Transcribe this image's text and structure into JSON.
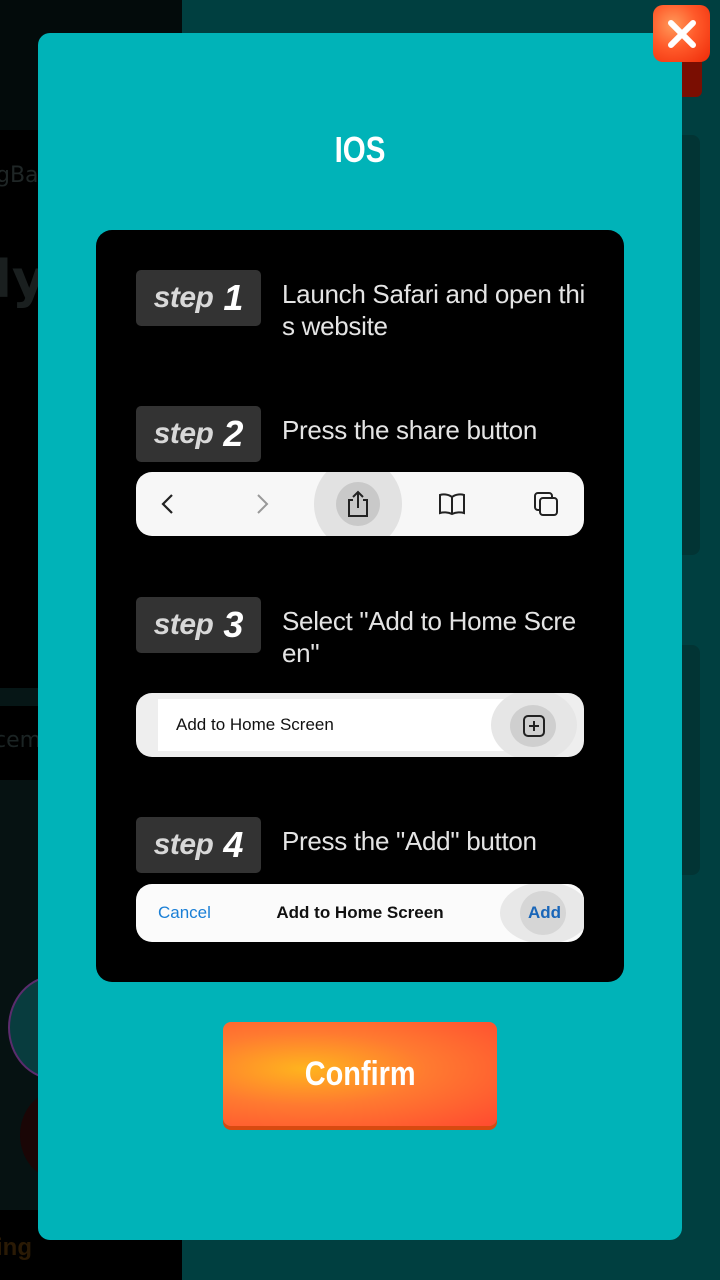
{
  "background": {
    "partial_texts": [
      "gBa",
      "ly",
      "cem",
      "ing"
    ]
  },
  "modal": {
    "title": "IOS",
    "close_icon": "close-x-icon",
    "colors": {
      "modal_bg": "#00b3b8",
      "panel_bg": "#000000",
      "badge_bg": "#333333",
      "confirm_gradient_start": "#ffb41e",
      "confirm_gradient_end": "#ff4a30",
      "close_button": "#ff5a2a",
      "ios_link_blue": "#1a7fd6"
    },
    "steps": [
      {
        "word": "step",
        "number": "1",
        "text": "Launch Safari and open this website"
      },
      {
        "word": "step",
        "number": "2",
        "text": "Press the share button"
      },
      {
        "word": "step",
        "number": "3",
        "text": "Select \"Add to Home Screen\""
      },
      {
        "word": "step",
        "number": "4",
        "text": "Press the \"Add\" button"
      }
    ],
    "safari_toolbar": {
      "icons": [
        "back-chevron-icon",
        "forward-chevron-icon",
        "share-icon",
        "bookmarks-book-icon",
        "tabs-icon"
      ]
    },
    "add_home_row": {
      "label": "Add to Home Screen",
      "icon": "plus-square-icon"
    },
    "add_confirm_bar": {
      "cancel": "Cancel",
      "title": "Add to Home Screen",
      "add": "Add"
    },
    "confirm_label": "Confirm"
  }
}
